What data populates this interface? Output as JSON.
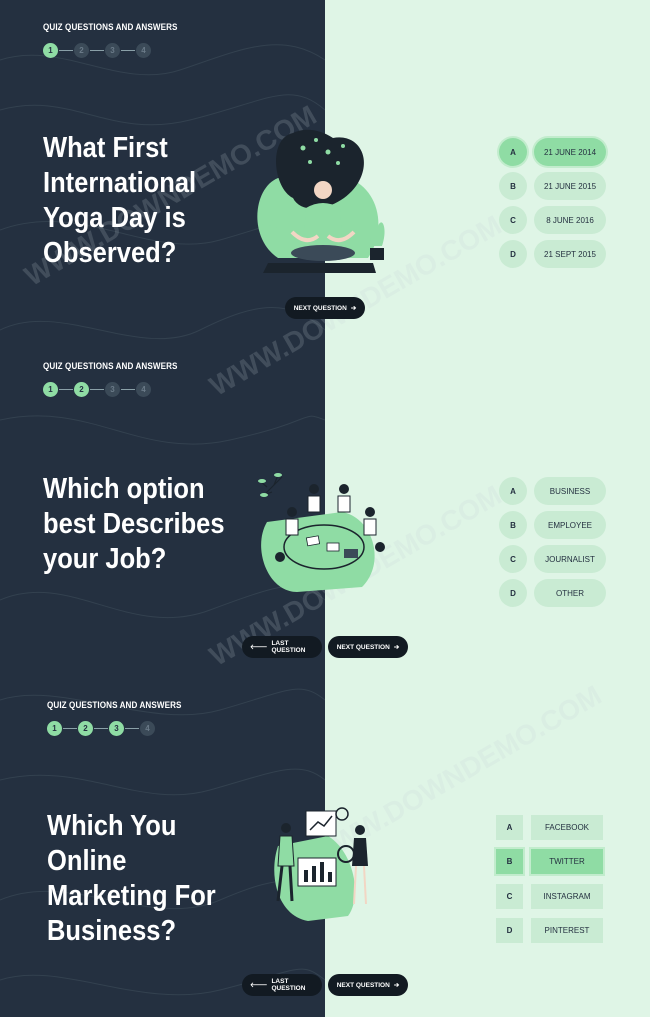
{
  "sections": [
    {
      "label": "QUIZ QUESTIONS AND ANSWERS",
      "steps": [
        "1",
        "2",
        "3",
        "4"
      ],
      "question": "What First\nInternational\nYoga Day is\nObserved?",
      "options": [
        {
          "letter": "A",
          "answer": "21 JUNE 2014",
          "selected": true
        },
        {
          "letter": "B",
          "answer": "21 JUNE 2015",
          "selected": false
        },
        {
          "letter": "C",
          "answer": "8 JUNE 2016",
          "selected": false
        },
        {
          "letter": "D",
          "answer": "21 SEPT 2015",
          "selected": false
        }
      ],
      "next": "NEXT QUESTION"
    },
    {
      "label": "QUIZ QUESTIONS AND ANSWERS",
      "steps": [
        "1",
        "2",
        "3",
        "4"
      ],
      "question": "Which option\nbest Describes\nyour Job?",
      "options": [
        {
          "letter": "A",
          "answer": "BUSINESS",
          "selected": false
        },
        {
          "letter": "B",
          "answer": "EMPLOYEE",
          "selected": false
        },
        {
          "letter": "C",
          "answer": "JOURNALIST",
          "selected": false
        },
        {
          "letter": "D",
          "answer": "OTHER",
          "selected": false
        }
      ],
      "last": "LAST QUESTION",
      "next": "NEXT QUESTION"
    },
    {
      "label": "QUIZ QUESTIONS AND ANSWERS",
      "steps": [
        "1",
        "2",
        "3",
        "4"
      ],
      "question": "Which You\nOnline\nMarketing For\nBusiness?",
      "options": [
        {
          "letter": "A",
          "answer": "FACEBOOK",
          "selected": false
        },
        {
          "letter": "B",
          "answer": "TWITTER",
          "selected": true
        },
        {
          "letter": "C",
          "answer": "INSTAGRAM",
          "selected": false
        },
        {
          "letter": "D",
          "answer": "PINTEREST",
          "selected": false
        }
      ],
      "last": "LAST QUESTION",
      "next": "NEXT QUESTION"
    }
  ],
  "watermark": "WWW.DOWNDEMO.COM",
  "colors": {
    "dark": "#243040",
    "mint": "#dff5e6",
    "accent": "#8fdca4"
  }
}
